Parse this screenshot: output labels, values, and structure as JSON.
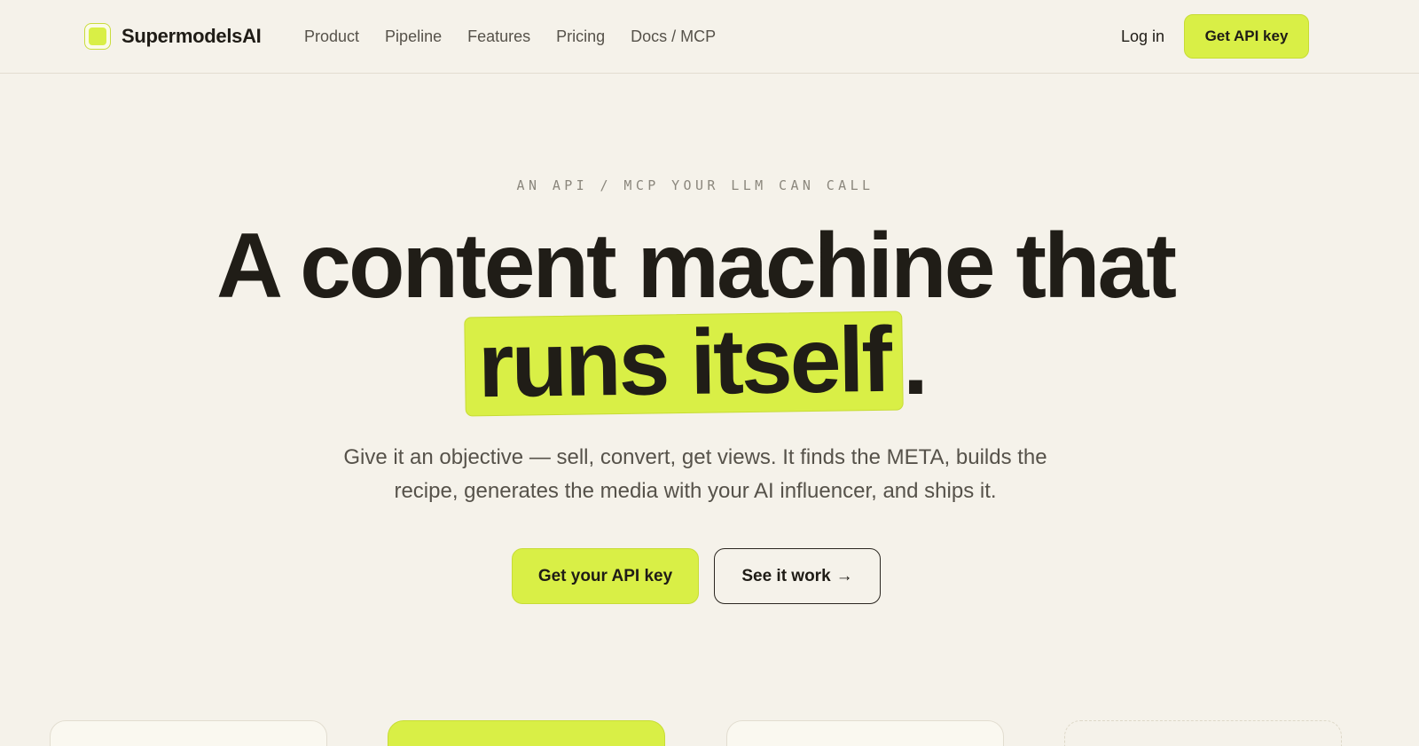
{
  "nav": {
    "brand": "SupermodelsAI",
    "links": [
      "Product",
      "Pipeline",
      "Features",
      "Pricing",
      "Docs / MCP"
    ],
    "login": "Log in",
    "cta": "Get API key"
  },
  "hero": {
    "eyebrow": "AN API / MCP YOUR LLM CAN CALL",
    "headline_line1": "A content machine that",
    "headline_highlight": "runs itself",
    "headline_end": ".",
    "subtitle": "Give it an objective — sell, convert, get views. It finds the META, builds the recipe, generates the media with your AI influencer, and ships it.",
    "cta_primary": "Get your API key",
    "cta_secondary": "See it work",
    "cta_secondary_arrow": "→"
  },
  "colors": {
    "background": "#f5f2ea",
    "accent": "#d9ef46",
    "text": "#1f1c16"
  }
}
